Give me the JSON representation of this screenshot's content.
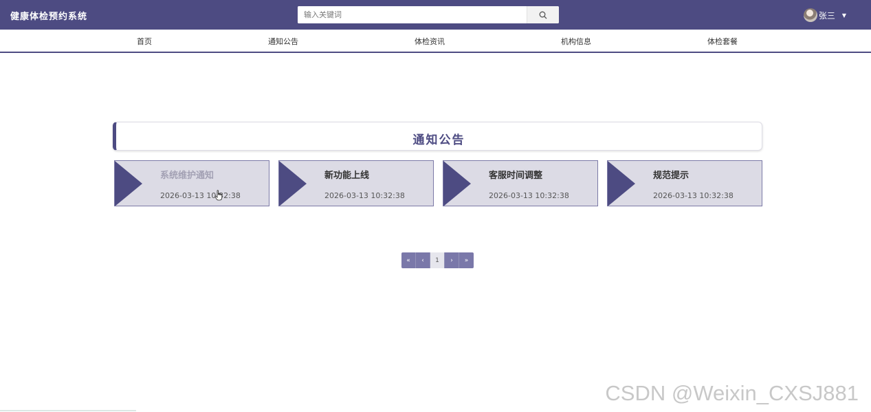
{
  "header": {
    "brand": "健康体检预约系统",
    "search": {
      "placeholder": "输入关键词",
      "value": ""
    },
    "user": {
      "name": "张三"
    }
  },
  "nav": {
    "items": [
      {
        "label": "首页"
      },
      {
        "label": "通知公告"
      },
      {
        "label": "体检资讯"
      },
      {
        "label": "机构信息"
      },
      {
        "label": "体检套餐"
      }
    ]
  },
  "main": {
    "section_title": "通知公告",
    "cards": [
      {
        "title": "系统维护通知",
        "date": "2026-03-13 10:32:38"
      },
      {
        "title": "新功能上线",
        "date": "2026-03-13 10:32:38"
      },
      {
        "title": "客服时间调整",
        "date": "2026-03-13 10:32:38"
      },
      {
        "title": "规范提示",
        "date": "2026-03-13 10:32:38"
      }
    ]
  },
  "pagination": {
    "first": "«",
    "prev": "‹",
    "current": "1",
    "next": "›",
    "last": "»"
  },
  "watermark": "CSDN @Weixin_CXSJ881",
  "colors": {
    "primary": "#4d4b82",
    "card_bg": "#dcdbe5",
    "pagination": "#7a78a9"
  },
  "icons": {
    "search": "search-icon",
    "caret": "caret-down-icon",
    "arrow": "play-triangle-icon",
    "cursor": "hand-pointer-icon"
  }
}
